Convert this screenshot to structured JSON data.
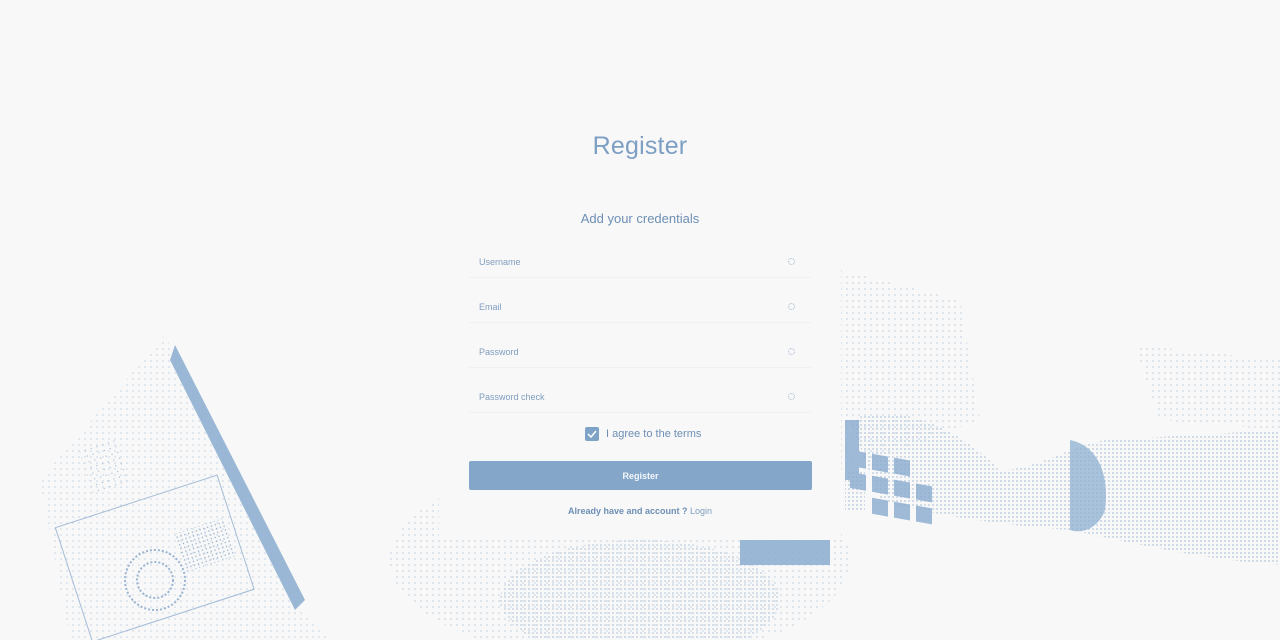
{
  "page": {
    "title": "Register"
  },
  "form": {
    "subtitle": "Add your credentials",
    "fields": [
      {
        "name": "username",
        "placeholder": "Username",
        "value": ""
      },
      {
        "name": "email",
        "placeholder": "Email",
        "value": ""
      },
      {
        "name": "password",
        "placeholder": "Password",
        "value": ""
      },
      {
        "name": "password_check",
        "placeholder": "Password check",
        "value": ""
      }
    ],
    "agree_label": "I agree to the terms",
    "agree_checked": true,
    "submit_label": "Register",
    "footer_question": "Already have and account ? ",
    "footer_link": "Login"
  },
  "colors": {
    "accent": "#84a6c8",
    "text": "#6d8fb5",
    "background": "#f8f8f8"
  }
}
